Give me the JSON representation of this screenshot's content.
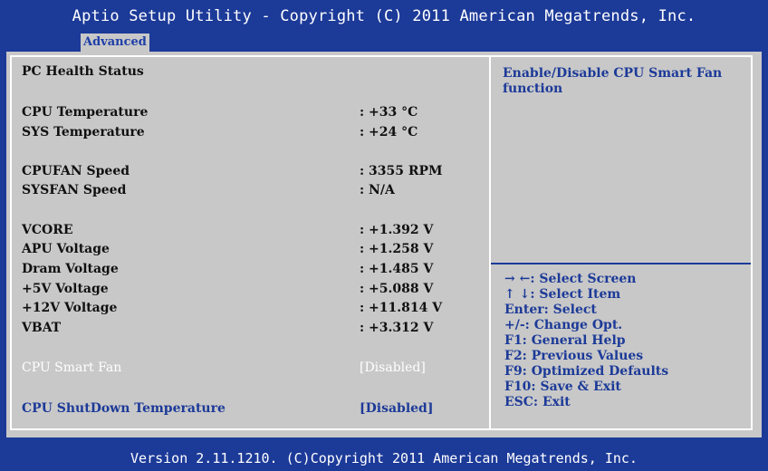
{
  "header": {
    "title": "Aptio Setup Utility - Copyright (C) 2011 American Megatrends, Inc.",
    "tab": "Advanced"
  },
  "main": {
    "section_title": "PC Health Status",
    "rows": [
      {
        "label": "CPU Temperature",
        "value": ": +33 °C"
      },
      {
        "label": "SYS Temperature",
        "value": ": +24 °C"
      },
      {
        "label": "CPUFAN Speed",
        "value": ": 3355 RPM"
      },
      {
        "label": "SYSFAN Speed",
        "value": ": N/A"
      },
      {
        "label": "VCORE",
        "value": ": +1.392 V"
      },
      {
        "label": "APU  Voltage",
        "value": ": +1.258 V"
      },
      {
        "label": "Dram Voltage",
        "value": ": +1.485 V"
      },
      {
        "label": "+5V  Voltage",
        "value": ": +5.088 V"
      },
      {
        "label": "+12V Voltage",
        "value": ": +11.814 V"
      },
      {
        "label": "VBAT",
        "value": ": +3.312 V"
      }
    ],
    "options": [
      {
        "label": "CPU Smart Fan",
        "value": "[Disabled]"
      },
      {
        "label": "CPU ShutDown Temperature",
        "value": "[Disabled]"
      }
    ]
  },
  "help": {
    "text": "Enable/Disable CPU Smart Fan function",
    "keys": [
      "→ ←: Select Screen",
      "↑ ↓: Select Item",
      "Enter: Select",
      "+/-:  Change Opt.",
      "F1: General Help",
      "F2: Previous Values",
      "F9: Optimized Defaults",
      "F10: Save & Exit",
      "ESC: Exit"
    ]
  },
  "footer": {
    "text": "Version 2.11.1210. (C)Copyright 2011 American Megatrends, Inc."
  },
  "colors": {
    "background": "#1c3a98",
    "panel": "#c8c8c8",
    "highlight_text": "#ffffff",
    "accent_text": "#1c3a98"
  }
}
